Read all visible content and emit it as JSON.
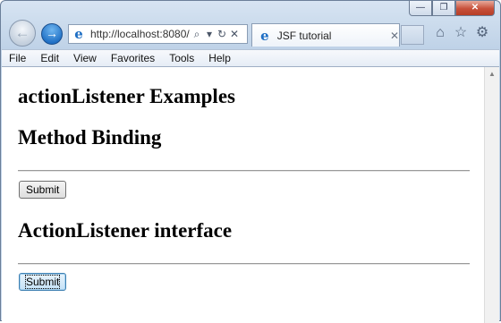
{
  "window": {
    "minimize_glyph": "—",
    "restore_glyph": "❐",
    "close_glyph": "✕"
  },
  "nav": {
    "back_glyph": "←",
    "forward_glyph": "→",
    "address": "http://localhost:8080/",
    "search_glyph": "⌕",
    "dropdown_glyph": "▾",
    "refresh_glyph": "↻",
    "stop_glyph": "✕",
    "ie_glyph": "e"
  },
  "tab": {
    "title": "JSF tutorial",
    "close_glyph": "✕"
  },
  "toolbar": {
    "home_glyph": "⌂",
    "favorites_glyph": "☆",
    "tools_glyph": "⚙"
  },
  "menu": [
    "File",
    "Edit",
    "View",
    "Favorites",
    "Tools",
    "Help"
  ],
  "content": {
    "title": "actionListener Examples",
    "section1_heading": "Method Binding",
    "submit1_label": "Submit",
    "section2_heading": "ActionListener interface",
    "submit2_label": "Submit"
  }
}
